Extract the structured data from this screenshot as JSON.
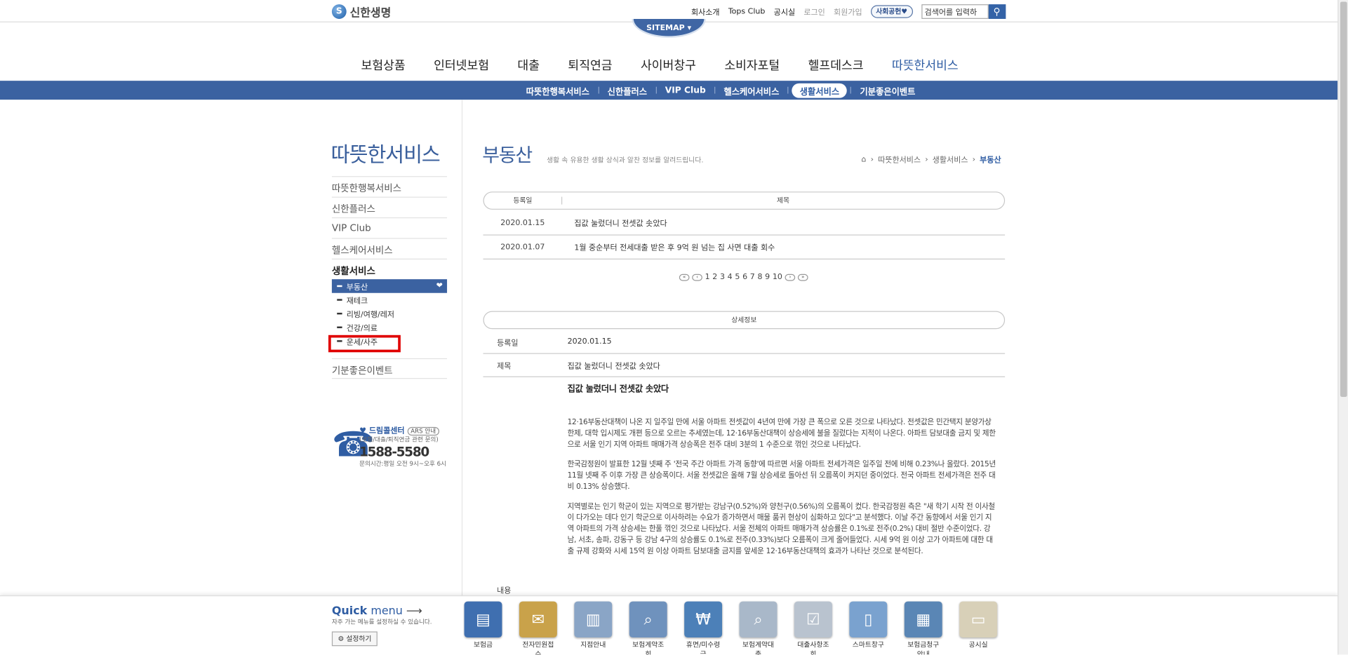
{
  "header": {
    "logo_text": "신한생명",
    "util_links": [
      "회사소개",
      "Tops Club",
      "공시실"
    ],
    "login": "로그인",
    "join": "회원가입",
    "social_badge": "사회공헌♥",
    "search_placeholder": "검색어를 입력하세요",
    "search_value": "검색어를 입력하",
    "sitemap": "SITEMAP ▾"
  },
  "gnb": [
    "보험상품",
    "인터넷보험",
    "대출",
    "퇴직연금",
    "사이버창구",
    "소비자포털",
    "헬프데스크",
    "따뜻한서비스"
  ],
  "lnb": [
    "따뜻한행복서비스",
    "신한플러스",
    "VIP Club",
    "헬스케어서비스",
    "생활서비스",
    "기분좋은이벤트"
  ],
  "sidebar": {
    "title": "따뜻한서비스",
    "items": [
      "따뜻한행복서비스",
      "신한플러스",
      "VIP Club",
      "헬스케어서비스",
      "생활서비스"
    ],
    "subitems": [
      "부동산",
      "재테크",
      "리빙/여행/레저",
      "건강/의료",
      "운세/사주"
    ],
    "last_item": "기분좋은이벤트",
    "dream": {
      "title": "드림콜센터",
      "ars": "ARS 안내",
      "desc": "(보험/대출/퇴직연금 관련 문의)",
      "phone": "1588-5580",
      "hours": "문의시간:평일 오전 9시~오후 6시"
    }
  },
  "content": {
    "title": "부동산",
    "desc": "생활 속 유용한 생활 상식과 알찬 정보를 알려드립니다.",
    "breadcrumb": [
      "따뜻한서비스",
      "생활서비스",
      "부동산"
    ],
    "list_header": {
      "date": "등록일",
      "subject": "제목"
    },
    "rows": [
      {
        "date": "2020.01.15",
        "subject": "집값 눌렀더니 전셋값 솟았다"
      },
      {
        "date": "2020.01.07",
        "subject": "1월 중순부터 전세대출 받은 후 9억 원 넘는 집 사면 대출 회수"
      }
    ],
    "pages": [
      "1",
      "2",
      "3",
      "4",
      "5",
      "6",
      "7",
      "8",
      "9",
      "10"
    ],
    "detail_header": "상세정보",
    "detail_date_label": "등록일",
    "detail_date": "2020.01.15",
    "detail_subject_label": "제목",
    "detail_subject": "집값 눌렀더니 전셋값 솟았다",
    "body_label": "내용",
    "body_title": "집값 눌렀더니 전셋값 솟았다",
    "paragraphs": [
      "12·16부동산대책이 나온 지 일주일 만에 서울 아파트 전셋값이 4년여 만에 가장 큰 폭으로 오른 것으로 나타났다. 전셋값은 민간택지 분양가상한제, 대학 입시제도 개편 등으로 오르는 추세였는데, 12·16부동산대책이 상승세에 불을 질렀다는 지적이 나온다. 아파트 담보대출 금지 및 제한으로 서울 인기 지역 아파트 매매가격 상승폭은 전주 대비 3분의 1 수준으로 꺾인 것으로 나타났다.",
      "한국감정원이 발표한 12월 넷째 주 '전국 주간 아파트 가격 동향'에 따르면 서울 아파트 전세가격은 일주일 전에 비해 0.23%나 올랐다. 2015년 11월 넷째 주 이후 가장 큰 상승폭이다. 서울 전셋값은 올해 7월 상승세로 돌아선 뒤 오름폭이 커지던 중이었다. 전국 아파트 전세가격은 전주 대비 0.13% 상승했다.",
      "지역별로는 인기 학군이 있는 지역으로 평가받는 강남구(0.52%)와 양천구(0.56%)의 오름폭이 컸다. 한국감정원 측은 \"새 학기 시작 전 이사철이 다가오는 데다 인기 학군으로 이사하려는 수요가 증가하면서 매물 품귀 현상이 심화하고 있다\"고 분석했다. 이날 주간 동향에서 서울 인기 지역 아파트의 가격 상승세는 한풀 꺾인 것으로 나타났다. 서울 전체의 아파트 매매가격 상승률은 0.1%로 전주(0.2%) 대비 절반 수준이었다. 강남, 서초, 송파, 강동구 등 강남 4구의 상승률도 0.1%로 전주(0.33%)보다 오름폭이 크게 줄어들었다. 시세 9억 원 이상 고가 아파트에 대한 대출 규제 강화와 시세 15억 원 이상 아파트 담보대출 금지를 앞세운 12·16부동산대책의 효과가 나타난 것으로 분석된다."
    ]
  },
  "quick": {
    "title_bold": "Quick",
    "title_rest": " menu",
    "desc": "자주 가는 메뉴를 설정하실 수 있습니다.",
    "settings": "설정하기",
    "items": [
      {
        "label": "보험금",
        "icon": "insurance-claim-icon",
        "color": "#3f6fb0"
      },
      {
        "label": "전자민원접수",
        "icon": "complaint-icon",
        "color": "#c9a24a"
      },
      {
        "label": "지점안내",
        "icon": "branch-icon",
        "color": "#8aa5c6"
      },
      {
        "label": "보험계약조회",
        "icon": "contract-search-icon",
        "color": "#6f92bd"
      },
      {
        "label": "휴면/미수령금",
        "icon": "dormant-money-icon",
        "color": "#4c80b8"
      },
      {
        "label": "보험계약대출",
        "icon": "contract-loan-icon",
        "color": "#a9b8c9"
      },
      {
        "label": "대출사항조회",
        "icon": "loan-search-icon",
        "color": "#b9c3cf"
      },
      {
        "label": "스마트창구",
        "icon": "smart-window-icon",
        "color": "#7aa2cf"
      },
      {
        "label": "보험금청구안내",
        "icon": "claim-guide-icon",
        "color": "#5a86b5"
      },
      {
        "label": "공시실",
        "icon": "public-notice-icon",
        "color": "#d8d0b8"
      }
    ]
  }
}
